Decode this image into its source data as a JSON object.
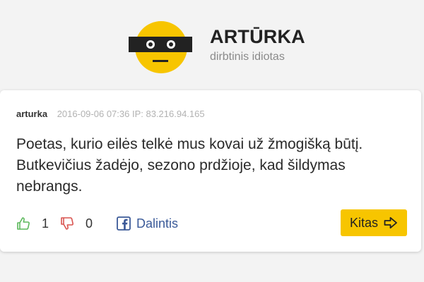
{
  "brand": {
    "title": "ARTŪRKA",
    "subtitle": "dirbtinis idiotas"
  },
  "comment": {
    "author": "arturka",
    "meta": "2016-09-06 07:36 IP: 83.216.94.165",
    "text": "Poetas, kurio eilės telkė mus kovai už žmogišką būtį. Butkevičius žadėjo, sezono prdžioje, kad šildymas nebrangs."
  },
  "actions": {
    "likes": "1",
    "dislikes": "0",
    "share_label": "Dalintis",
    "next_label": "Kitas"
  },
  "icons": {
    "like": "thumbs-up-icon",
    "dislike": "thumbs-down-icon",
    "share": "facebook-icon",
    "next": "arrow-right-icon"
  },
  "colors": {
    "accent": "#f7c500",
    "like": "#5cb85c",
    "dislike": "#d9534f",
    "facebook": "#3b5998"
  }
}
